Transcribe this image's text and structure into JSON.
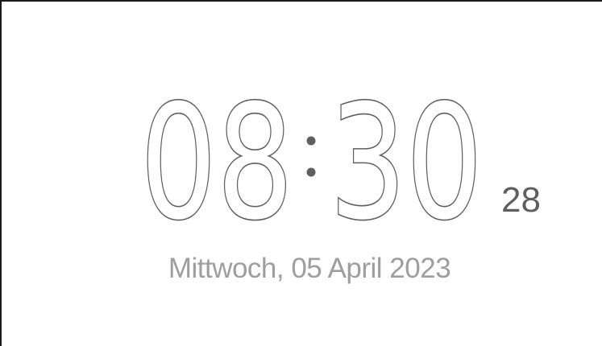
{
  "clock": {
    "hours": "08",
    "minutes": "30",
    "seconds": "28",
    "separator": ":",
    "date": "Mittwoch, 05 April 2023"
  },
  "colors": {
    "digits": "#5f5f5f",
    "date": "#9e9e9e",
    "background": "#ffffff",
    "frame": "#1a1a1a"
  }
}
